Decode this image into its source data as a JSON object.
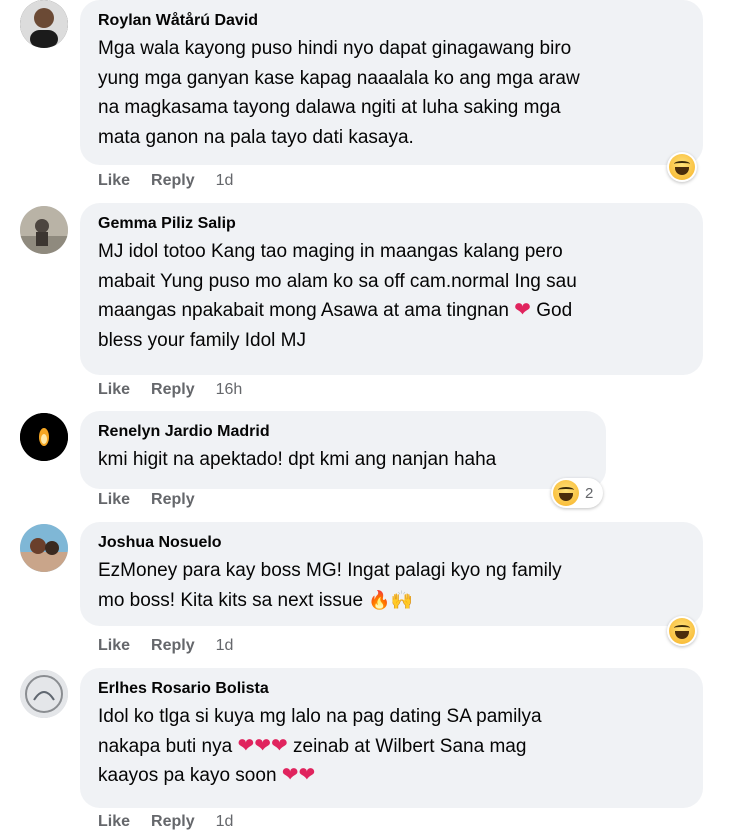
{
  "comments": [
    {
      "author": "Roylan Wåtårú David",
      "lines": [
        "Mga wala kayong puso hindi nyo dapat ginagawang biro",
        "yung mga ganyan kase kapag naaalala ko ang mga araw",
        "na magkasama tayong dalawa ngiti at luha saking mga",
        "mata ganon na pala tayo dati kasaya."
      ],
      "like": "Like",
      "reply": "Reply",
      "time": "1d",
      "reaction": "haha",
      "reaction_count": ""
    },
    {
      "author": "Gemma Piliz Salip",
      "lines": [
        "MJ idol totoo Kang tao maging in maangas kalang pero",
        "mabait Yung puso mo alam ko sa off cam.normal Ing sau",
        "maangas npakabait mong Asawa at ama tingnan",
        "God",
        "bless your family Idol MJ"
      ],
      "like": "Like",
      "reply": "Reply",
      "time": "16h"
    },
    {
      "author": "Renelyn Jardio Madrid",
      "lines": [
        "kmi higit na apektado! dpt kmi ang nanjan haha"
      ],
      "like": "Like",
      "reply": "Reply",
      "time": "",
      "reaction": "haha",
      "reaction_count": "2"
    },
    {
      "author": "Joshua Nosuelo",
      "lines": [
        "EzMoney para kay boss MG! Ingat palagi kyo ng family",
        "mo boss! Kita kits sa next issue"
      ],
      "like": "Like",
      "reply": "Reply",
      "time": "1d",
      "reaction": "haha",
      "reaction_count": ""
    },
    {
      "author": "Erlhes Rosario Bolista",
      "lines": [
        "Idol ko tlga si kuya mg lalo na pag dating SA pamilya",
        "nakapa buti nya",
        "zeinab at Wilbert Sana mag",
        "kaayos pa kayo soon"
      ],
      "like": "Like",
      "reply": "Reply",
      "time": "1d"
    }
  ],
  "colors": {
    "bubble": "#f0f2f5",
    "meta": "#65676b",
    "heart": "#e0245e"
  },
  "icons": {
    "heart": "heart-icon",
    "haha": "haha-reaction-icon",
    "fire": "fire-icon",
    "hands": "raising-hands-icon"
  }
}
